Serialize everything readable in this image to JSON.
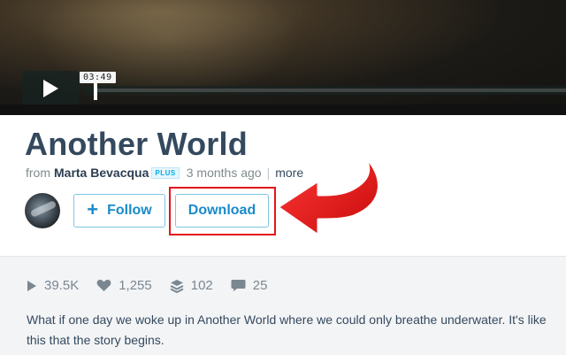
{
  "video": {
    "time": "03:49",
    "progress": 0.005
  },
  "clip": {
    "title": "Another World",
    "from_label": "from",
    "author": "Marta Bevacqua",
    "badge": "PLUS",
    "uploaded": "3 months ago",
    "separator": "|",
    "more_label": "more"
  },
  "actions": {
    "follow_label": "Follow",
    "download_label": "Download"
  },
  "stats": {
    "plays": "39.5K",
    "likes": "1,255",
    "collections": "102",
    "comments": "25"
  },
  "description": "What if one day we woke up in Another World where we could only breathe underwater. It's like this that the story begins.",
  "colors": {
    "accent": "#1a8bc8",
    "highlight": "#e3161b",
    "title": "#34495e"
  },
  "icons": [
    "play-icon",
    "plus-icon",
    "plays-icon",
    "heart-icon",
    "layers-icon",
    "comment-icon",
    "red-arrow"
  ]
}
